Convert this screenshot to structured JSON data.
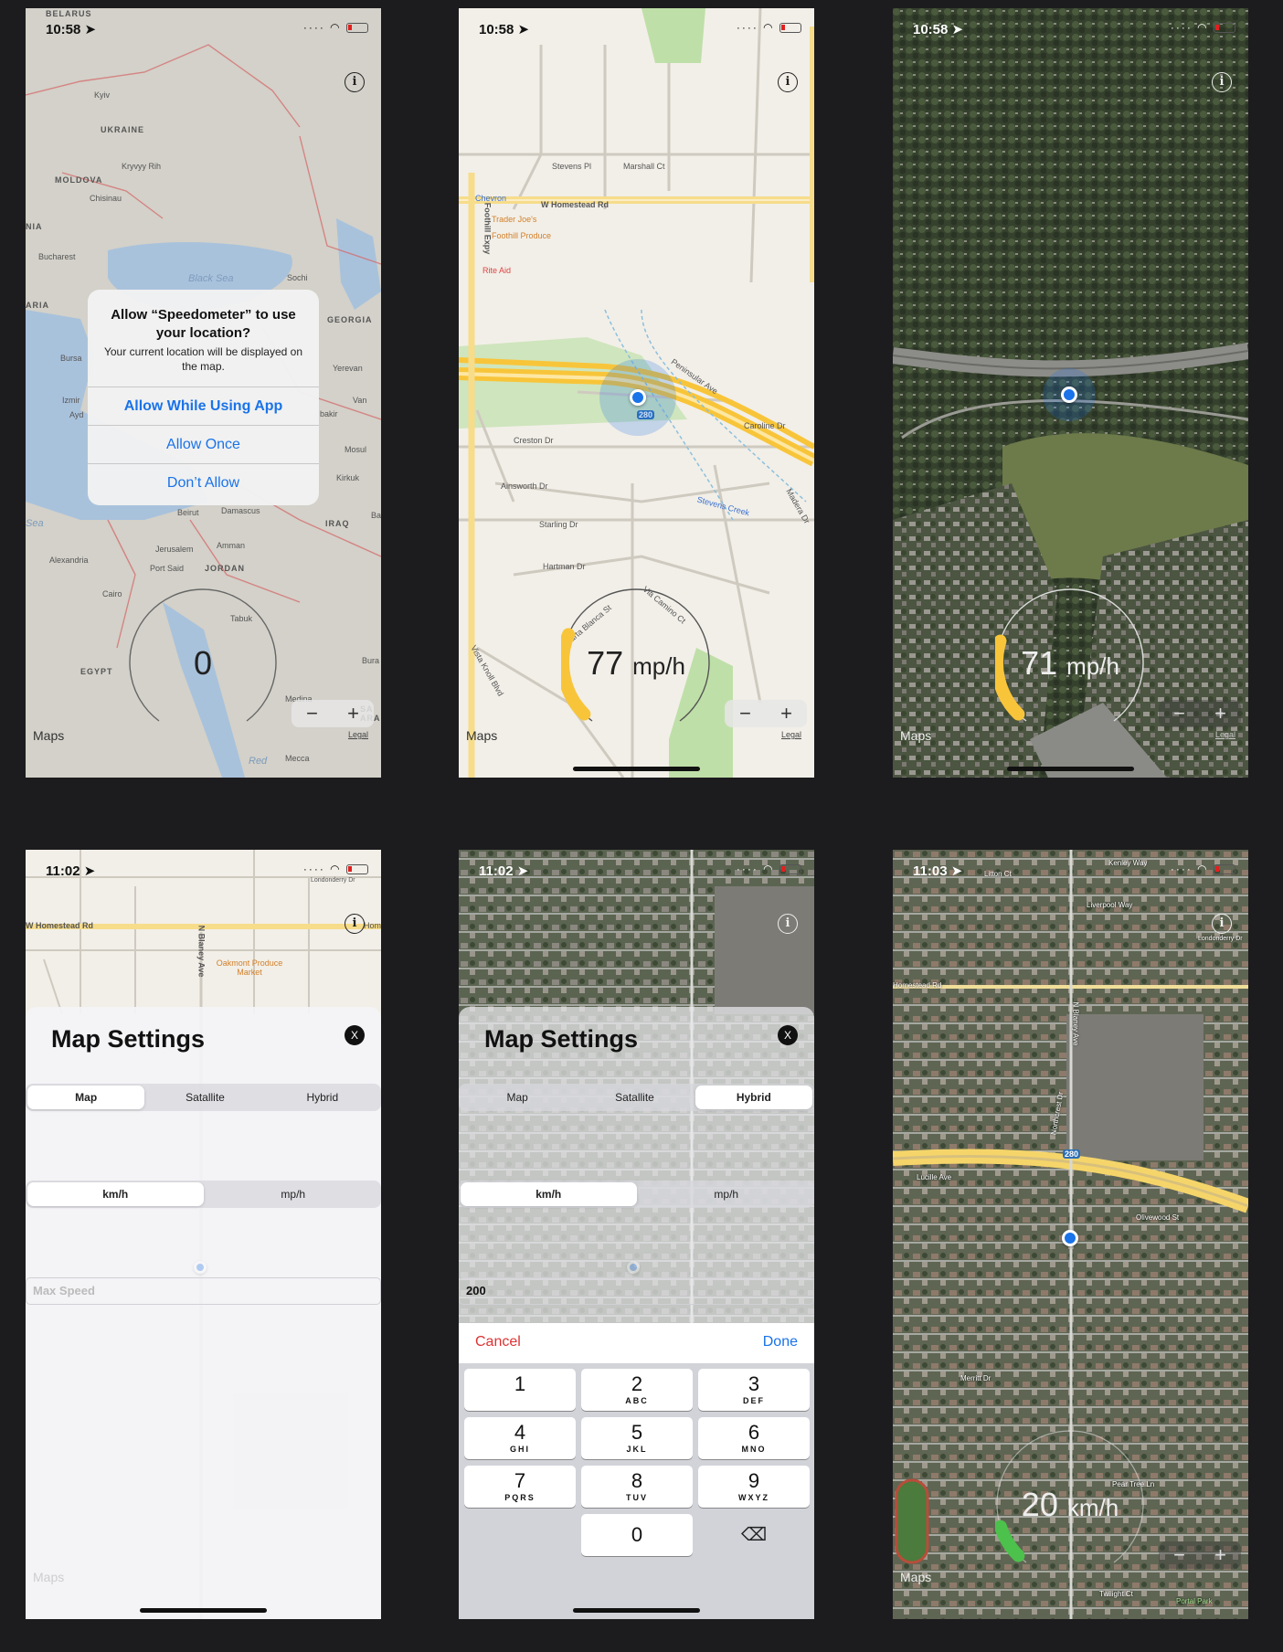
{
  "status": {
    "time_p1": "10:58",
    "time_p2": "10:58",
    "time_p3": "10:58",
    "time_p4": "11:02",
    "time_p5": "11:02",
    "time_p6": "11:03"
  },
  "common": {
    "info_glyph": "i",
    "maps_logo": "Maps",
    "legal": "Legal",
    "zoom_out": "−",
    "zoom_in": "+",
    "nav_icon": "location-arrow-icon"
  },
  "p1": {
    "alert": {
      "title": "Allow “Speedometer” to use your location?",
      "message": "Your current location will be displayed on the map.",
      "btn_allow_while_using": "Allow While Using App",
      "btn_allow_once": "Allow Once",
      "btn_dont_allow": "Don’t Allow"
    },
    "speed_value": "0",
    "speed_fraction": 0,
    "map_labels": [
      "BELARUS",
      "Kyiv",
      "UKRAINE",
      "Kryvyy Rih",
      "MOLDOVA",
      "Chisinau",
      "NIA",
      "Bucharest",
      "Black Sea",
      "Sochi",
      "ARIA",
      "GEORGIA",
      "Bursa",
      "Izmir",
      "Ayd",
      "Yerevan",
      "Van",
      "bakir",
      "Mosul",
      "Kirkuk",
      "Sea",
      "Beirut",
      "Damascus",
      "IRAQ",
      "Ba",
      "Alexandria",
      "Jerusalem",
      "Amman",
      "Port Said",
      "JORDAN",
      "Cairo",
      "Tabuk",
      "EGYPT",
      "Bura",
      "Medina",
      "SA ARA",
      "Mecca",
      "Red"
    ]
  },
  "p2": {
    "speed_value": "77",
    "speed_unit": "mp/h",
    "speed_fraction": 0.25,
    "map_labels": [
      "Chevron",
      "W Homestead Rd",
      "Trader Joe's",
      "Foothill Produce",
      "Rite Aid",
      "Foothill Expy",
      "Stevens Pl",
      "Marshall Ct",
      "Creston Dr",
      "Ainsworth Dr",
      "Starling Dr",
      "Hartman Dr",
      "Caroline Dr",
      "Peninsular Ave",
      "Stevens Creek",
      "Via Camino Ct",
      "Carta Blanca St",
      "Vista Knoll Blvd",
      "Madera Dr",
      "280"
    ]
  },
  "p3": {
    "speed_value": "71",
    "speed_unit": "mp/h",
    "speed_fraction": 0.23
  },
  "p4": {
    "sheet_title": "Map Settings",
    "close_label": "X",
    "map_types": [
      "Map",
      "Satallite",
      "Hybrid"
    ],
    "map_type_selected": "Map",
    "units": [
      "km/h",
      "mp/h"
    ],
    "unit_selected": "km/h",
    "max_speed_placeholder": "Max Speed",
    "map_labels": [
      "W Homestead Rd",
      "N Blaney Ave",
      "Oakmont Produce Market",
      "Londonderry Dr",
      "Hom"
    ]
  },
  "p5": {
    "sheet_title": "Map Settings",
    "close_label": "X",
    "map_types": [
      "Map",
      "Satallite",
      "Hybrid"
    ],
    "map_type_selected": "Hybrid",
    "units": [
      "km/h",
      "mp/h"
    ],
    "unit_selected": "km/h",
    "max_speed_value": "200",
    "keyboard": {
      "cancel": "Cancel",
      "done": "Done",
      "keys": [
        {
          "n": "1",
          "l": ""
        },
        {
          "n": "2",
          "l": "ABC"
        },
        {
          "n": "3",
          "l": "DEF"
        },
        {
          "n": "4",
          "l": "GHI"
        },
        {
          "n": "5",
          "l": "JKL"
        },
        {
          "n": "6",
          "l": "MNO"
        },
        {
          "n": "7",
          "l": "PQRS"
        },
        {
          "n": "8",
          "l": "TUV"
        },
        {
          "n": "9",
          "l": "WXYZ"
        },
        {
          "n": "0",
          "l": ""
        }
      ],
      "delete_icon": "backspace-icon"
    }
  },
  "p6": {
    "speed_value": "20",
    "speed_unit": "km/h",
    "speed_fraction": 0.1,
    "map_labels": [
      "Litton Ct",
      "Kenley Way",
      "Liverpool Way",
      "Londonderry Dr",
      "Homestead Rd",
      "N Blaney Ave",
      "Northcrest Dr",
      "Lucille Ave",
      "Olivewood St",
      "Merritt Dr",
      "Pear Tree Ln",
      "Twilight Ct",
      "Portal Park",
      "280"
    ]
  },
  "colors": {
    "accent_blue": "#1a73e8",
    "gauge_yellow": "#f8c53a",
    "gauge_green": "#4cc14c",
    "cancel_red": "#d33333"
  }
}
